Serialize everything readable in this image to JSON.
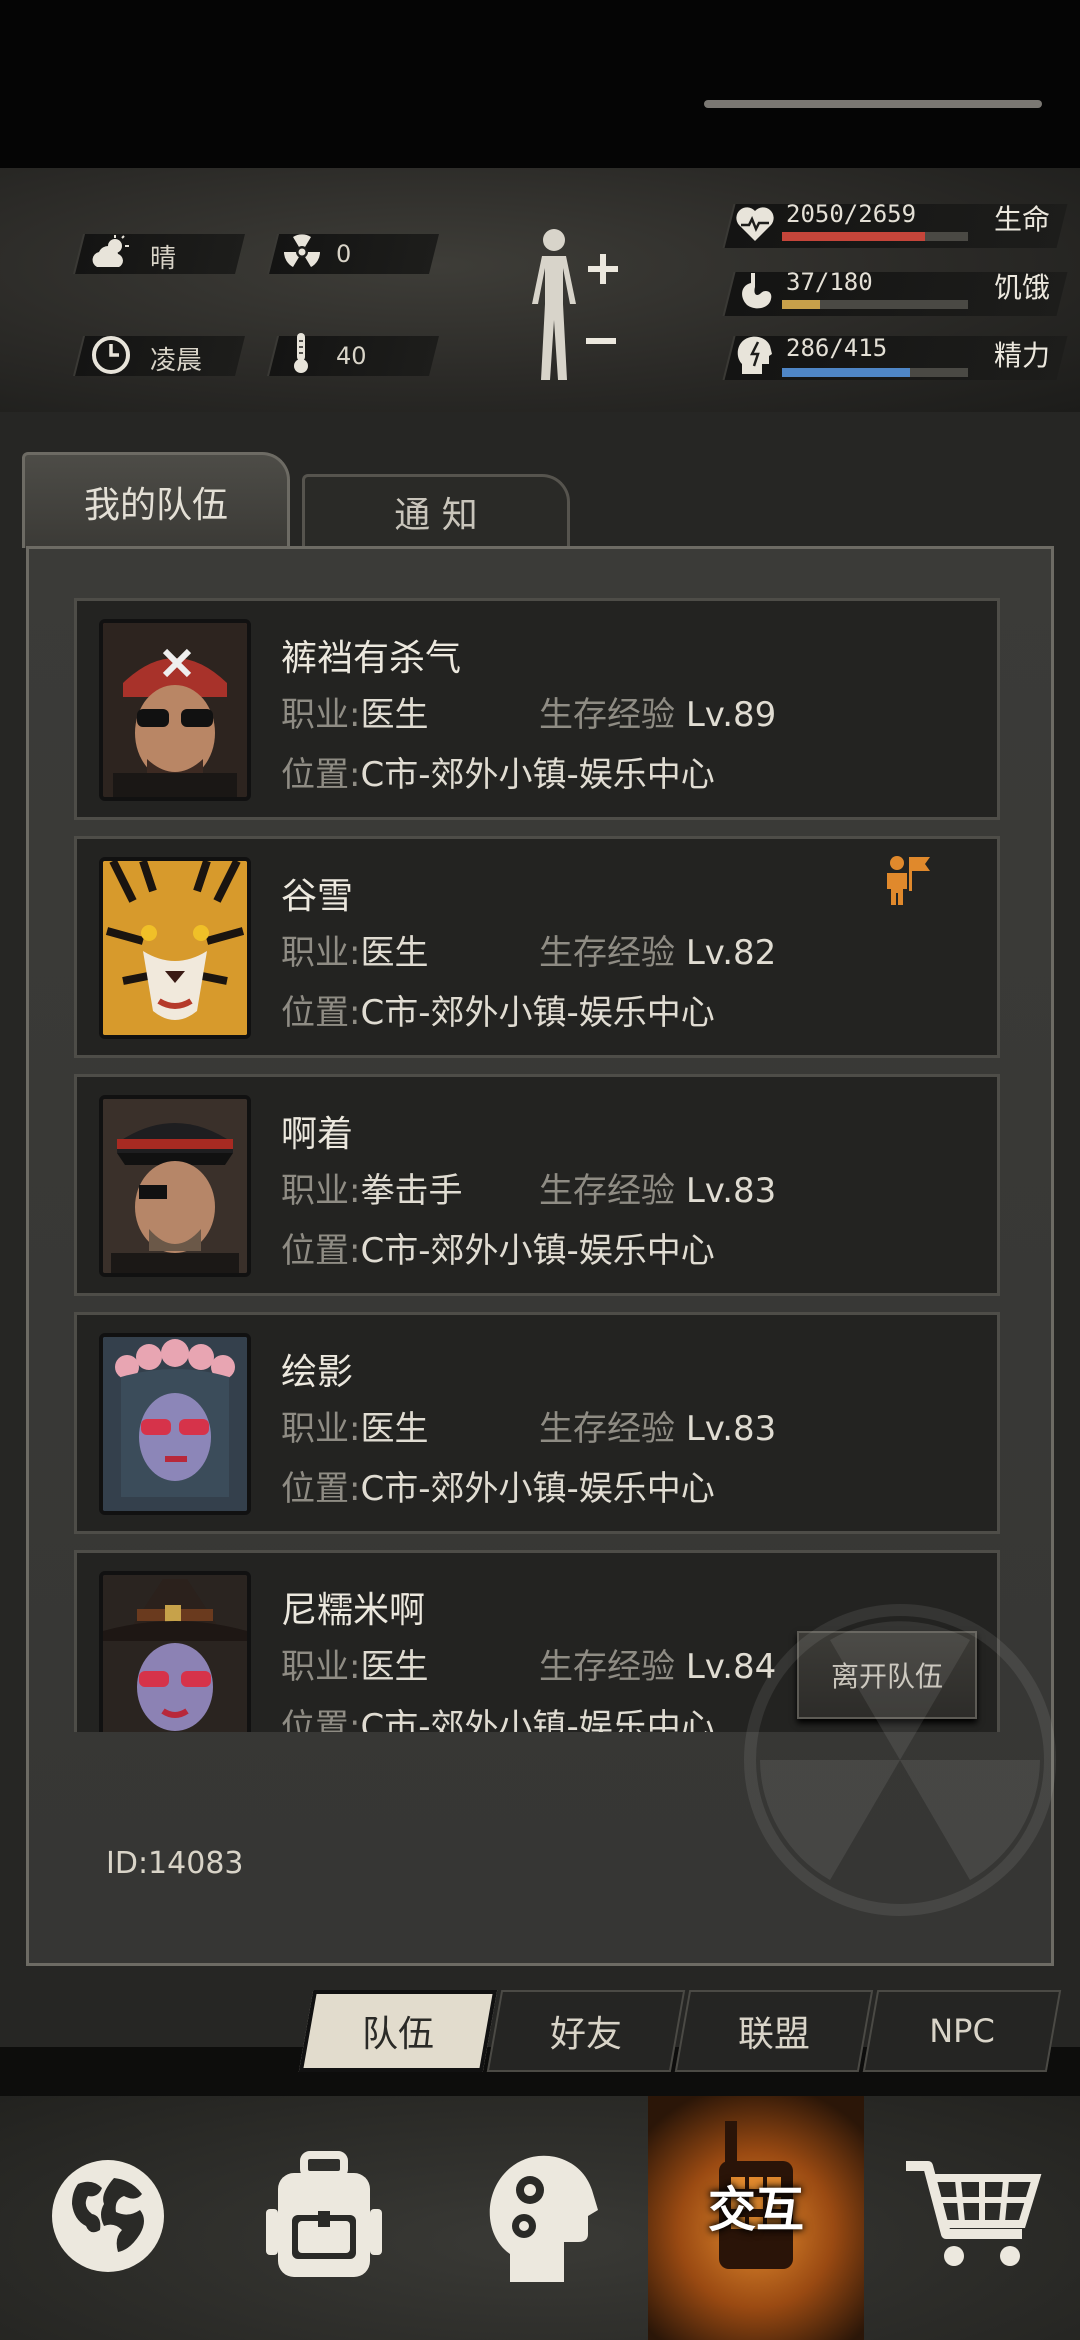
{
  "header": {
    "weather": {
      "icon": "cloud-sun-icon",
      "label": "晴"
    },
    "radiation": {
      "icon": "radiation-icon",
      "value": "0"
    },
    "time": {
      "icon": "clock-icon",
      "label": "凌晨"
    },
    "temperature": {
      "icon": "thermometer-icon",
      "value": "40"
    },
    "body_icon": "body-figure-icon",
    "stats": [
      {
        "icon": "heart-icon",
        "text": "2050/2659",
        "label": "生命",
        "current": 2050,
        "max": 2659,
        "color": "#c5453a"
      },
      {
        "icon": "stomach-icon",
        "text": "37/180",
        "label": "饥饿",
        "current": 37,
        "max": 180,
        "color": "#c8a04a"
      },
      {
        "icon": "brain-icon",
        "text": "286/415",
        "label": "精力",
        "current": 286,
        "max": 415,
        "color": "#4f86c6"
      }
    ]
  },
  "tabs": {
    "team": "我的队伍",
    "notice": "通 知"
  },
  "members": [
    {
      "name": "裤裆有杀气",
      "job_label": "职业:",
      "job": "医生",
      "exp_label": "生存经验",
      "level": "Lv.89",
      "loc_label": "位置:",
      "location": "C市-郊外小镇-娱乐中心",
      "leader": false
    },
    {
      "name": "谷雪",
      "job_label": "职业:",
      "job": "医生",
      "exp_label": "生存经验",
      "level": "Lv.82",
      "loc_label": "位置:",
      "location": "C市-郊外小镇-娱乐中心",
      "leader": true
    },
    {
      "name": "啊着",
      "job_label": "职业:",
      "job": "拳击手",
      "exp_label": "生存经验",
      "level": "Lv.83",
      "loc_label": "位置:",
      "location": "C市-郊外小镇-娱乐中心",
      "leader": false
    },
    {
      "name": "绘影",
      "job_label": "职业:",
      "job": "医生",
      "exp_label": "生存经验",
      "level": "Lv.83",
      "loc_label": "位置:",
      "location": "C市-郊外小镇-娱乐中心",
      "leader": false
    },
    {
      "name": "尼糯米啊",
      "job_label": "职业:",
      "job": "医生",
      "exp_label": "生存经验",
      "level": "Lv.84",
      "loc_label": "位置:",
      "location": "C市-郊外小镇-娱乐中心",
      "leader": false
    }
  ],
  "leave_button": "离开队伍",
  "id_text": "ID:14083",
  "subtabs": [
    "队伍",
    "好友",
    "联盟",
    "NPC"
  ],
  "nav": {
    "map_icon": "globe-icon",
    "bag_icon": "backpack-icon",
    "skills_icon": "head-gears-icon",
    "interact_icon": "walkie-talkie-icon",
    "interact_label": "交互",
    "shop_icon": "cart-icon"
  }
}
